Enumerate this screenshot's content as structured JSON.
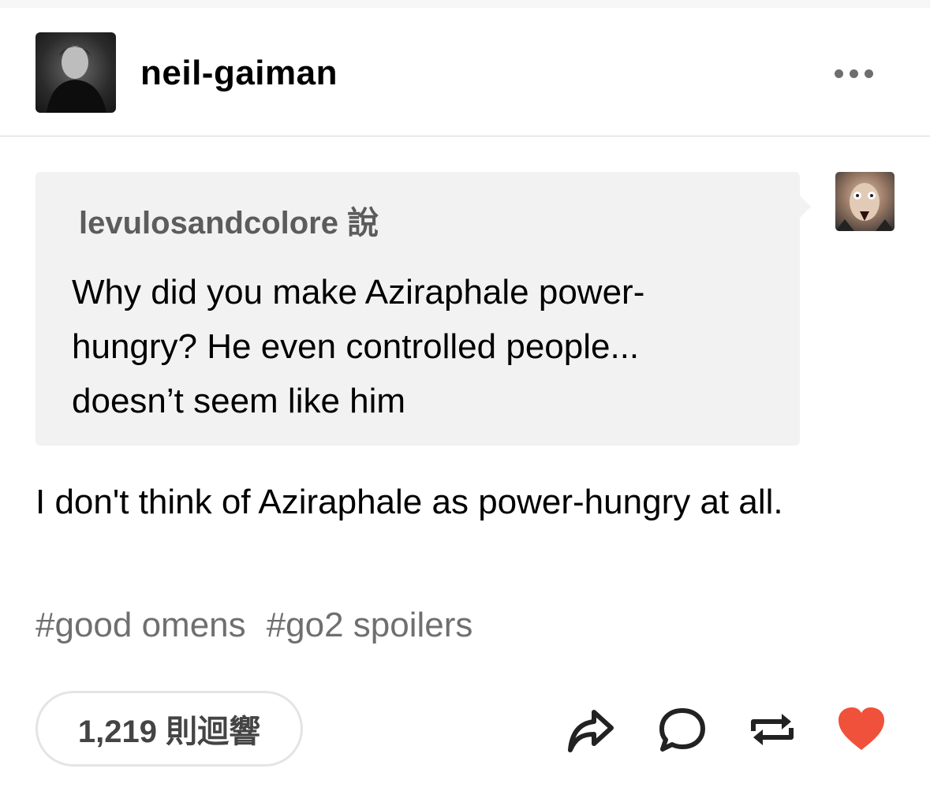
{
  "post": {
    "blog_name": "neil-gaiman",
    "ask": {
      "asker": "levulosandcolore 說",
      "question": "Why did you make Aziraphale power-hungry? He even controlled people... doesn’t seem like him"
    },
    "answer": "I don't think of Aziraphale as power-hungry at all.",
    "tags": [
      "#good omens",
      "#go2 spoilers"
    ],
    "notes": "1,219 則迴響"
  },
  "icons": {
    "more": "more-dots-icon",
    "share": "share-icon",
    "reply": "reply-icon",
    "reblog": "reblog-icon",
    "like": "heart-icon"
  },
  "colors": {
    "like": "#f0513a",
    "icon": "#222222",
    "tag": "#6f6f6f",
    "ask_bg": "#f2f2f2"
  }
}
